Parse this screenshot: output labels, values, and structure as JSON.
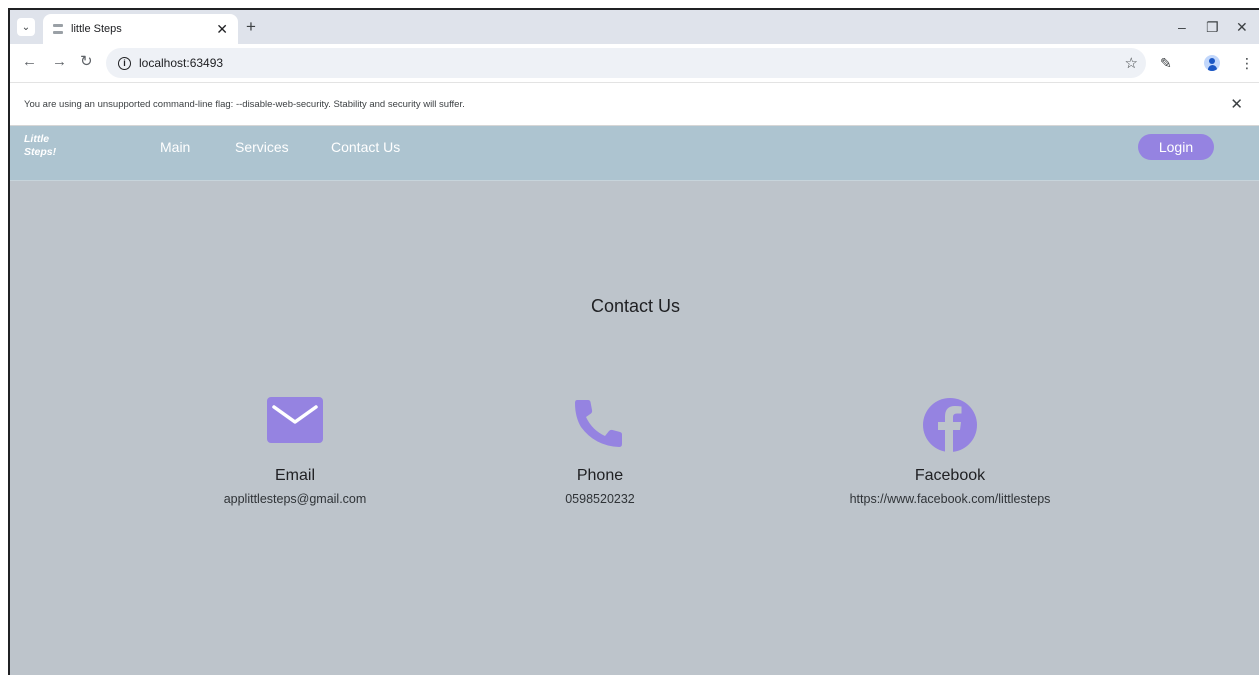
{
  "browser": {
    "tab_title": "little Steps",
    "url": "localhost:63493",
    "warning": "You are using an unsupported command-line flag: --disable-web-security. Stability and security will suffer."
  },
  "app": {
    "logo_line1": "Little",
    "logo_line2": "Steps!",
    "nav": [
      "Main",
      "Services",
      "Contact Us"
    ],
    "login_label": "Login",
    "accent_color": "#9583e1"
  },
  "contact": {
    "heading": "Contact Us",
    "items": [
      {
        "icon": "email-icon",
        "title": "Email",
        "value": "applittlesteps@gmail.com"
      },
      {
        "icon": "phone-icon",
        "title": "Phone",
        "value": "0598520232"
      },
      {
        "icon": "facebook-icon",
        "title": "Facebook",
        "value": "https://www.facebook.com/littlesteps"
      }
    ]
  }
}
